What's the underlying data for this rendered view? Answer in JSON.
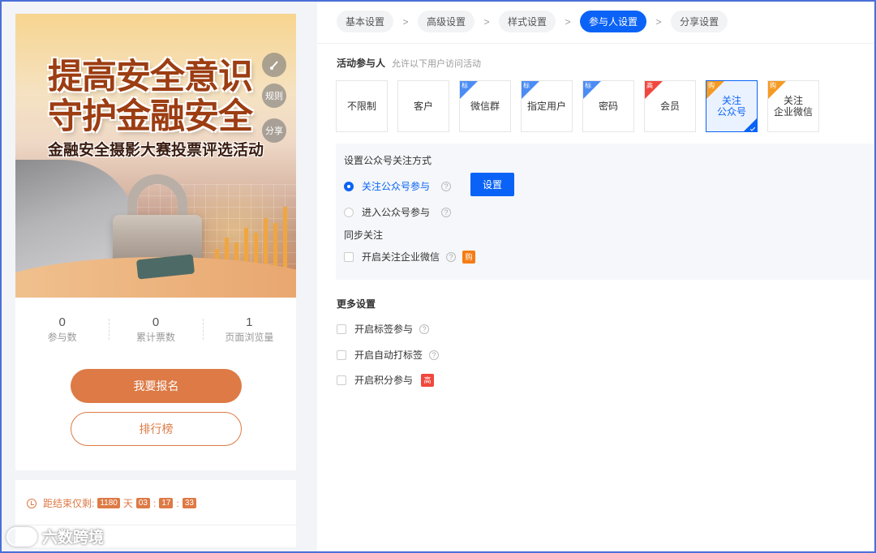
{
  "preview": {
    "banner": {
      "title_line1": "提高安全意识",
      "title_line2": "守护金融安全",
      "subtitle": "金融安全摄影大赛投票评选活动",
      "fab_rules": "规则",
      "fab_share": "分享",
      "fab_music_icon": "music-icon"
    },
    "stats": [
      {
        "value": "0",
        "label": "参与数"
      },
      {
        "value": "0",
        "label": "累计票数"
      },
      {
        "value": "1",
        "label": "页面浏览量"
      }
    ],
    "signup_button": "我要报名",
    "rank_button": "排行榜",
    "countdown": {
      "prefix": "距结束仅剩:",
      "days": "1180",
      "day_unit": "天",
      "hours": "03",
      "minutes": "17",
      "seconds": "33",
      "colon": ":"
    }
  },
  "watermark": "六数跨境",
  "steps": [
    {
      "label": "基本设置",
      "active": false
    },
    {
      "label": "高级设置",
      "active": false
    },
    {
      "label": "样式设置",
      "active": false
    },
    {
      "label": "参与人设置",
      "active": true
    },
    {
      "label": "分享设置",
      "active": false
    }
  ],
  "step_separator": ">",
  "participants": {
    "title": "活动参与人",
    "hint": "允许以下用户访问活动",
    "options": [
      {
        "label": "不限制",
        "corner": ""
      },
      {
        "label": "客户",
        "corner": ""
      },
      {
        "label": "微信群",
        "corner": "标"
      },
      {
        "label": "指定用户",
        "corner": "标"
      },
      {
        "label": "密码",
        "corner": "标"
      },
      {
        "label": "会员",
        "corner": "高"
      },
      {
        "label": "关注\n公众号",
        "corner": "购",
        "selected": true
      },
      {
        "label": "关注\n企业微信",
        "corner": "购"
      }
    ]
  },
  "follow_settings": {
    "title": "设置公众号关注方式",
    "option1": "关注公众号参与",
    "option2": "进入公众号参与",
    "set_button": "设置",
    "sync_title": "同步关注",
    "sync_option": "开启关注企业微信",
    "sync_tag": "购"
  },
  "more_settings": {
    "title": "更多设置",
    "items": [
      {
        "label": "开启标签参与",
        "tag": ""
      },
      {
        "label": "开启自动打标签",
        "tag": ""
      },
      {
        "label": "开启积分参与",
        "tag": "高"
      }
    ]
  },
  "help_glyph": "?",
  "colors": {
    "primary": "#0a63f6",
    "accent_orange": "#dd7a45",
    "tag_red": "#f0483e",
    "tag_orange": "#f57c14",
    "tag_blue": "#4b8cf5"
  }
}
